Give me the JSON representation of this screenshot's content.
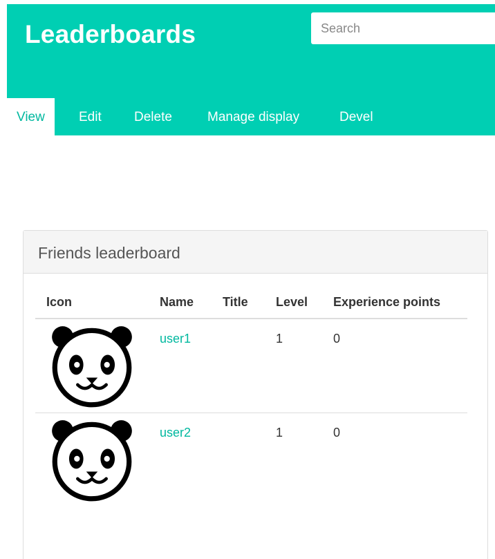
{
  "header": {
    "site_title": "Leaderboards",
    "search_placeholder": "Search",
    "accent_color": "#00cfb3"
  },
  "tabs": [
    {
      "label": "View",
      "active": true
    },
    {
      "label": "Edit",
      "active": false
    },
    {
      "label": "Delete",
      "active": false
    },
    {
      "label": "Manage display",
      "active": false
    },
    {
      "label": "Devel",
      "active": false
    }
  ],
  "block": {
    "title": "Friends leaderboard",
    "columns": [
      "Icon",
      "Name",
      "Title",
      "Level",
      "Experience points"
    ],
    "rows": [
      {
        "icon": "panda-icon",
        "name": "user1",
        "title": "",
        "level": "1",
        "experience_points": "0"
      },
      {
        "icon": "panda-icon",
        "name": "user2",
        "title": "",
        "level": "1",
        "experience_points": "0"
      }
    ]
  }
}
